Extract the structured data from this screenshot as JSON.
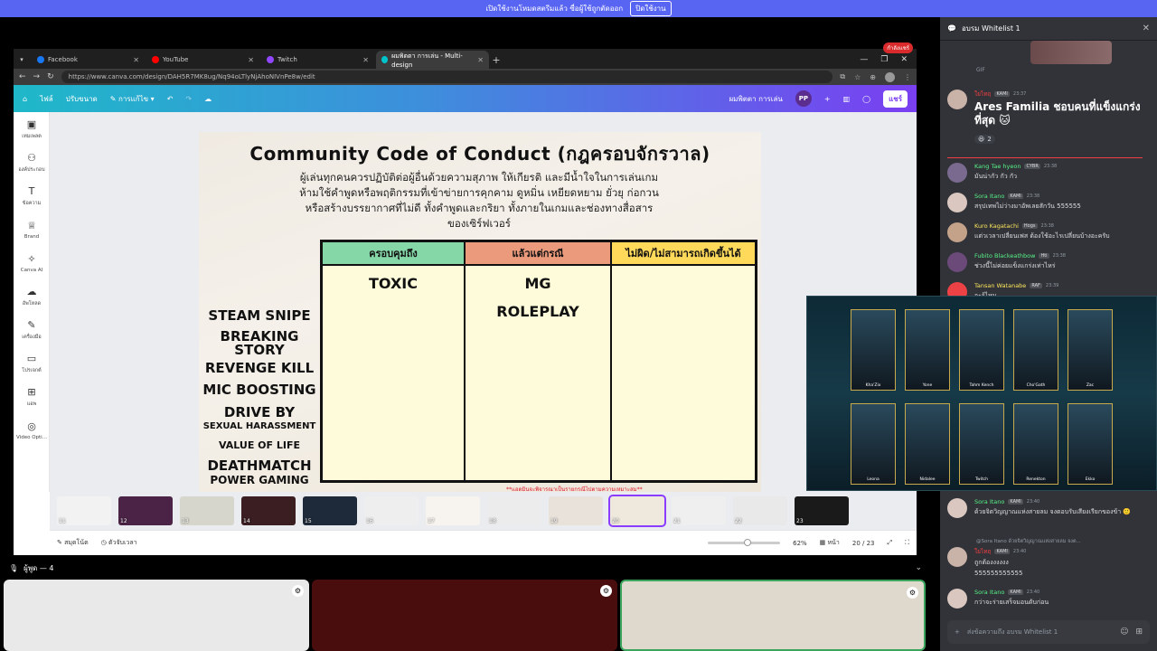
{
  "banner": {
    "text": "เปิดใช้งานโหมดสตรีมแล้ว ซื่อผู้ใช้ถูกตัดออก",
    "button": "ปิดใช้งาน"
  },
  "browser": {
    "tabs": [
      {
        "label": "Facebook",
        "color": "#1877f2"
      },
      {
        "label": "YouTube",
        "color": "#ff0000"
      },
      {
        "label": "Twitch",
        "color": "#9146ff"
      },
      {
        "label": "ผมพิตตา การเล่น - Multi-design",
        "color": "#00c4cc"
      }
    ],
    "rec_badge": "กำลังแชร์",
    "url": "https://www.canva.com/design/DAH5R7MK8ug/Nq94oLTlyNjAhoNIVnPe8w/edit"
  },
  "canva": {
    "top_left": [
      "ไฟล์",
      "ปรับขนาด",
      "การแก้ไข"
    ],
    "doc_name": "ผมพิตตา การเล่น",
    "avatar": "PP",
    "share": "แชร์",
    "sidebar": [
      {
        "icon": "▣",
        "label": "เทมเพลต"
      },
      {
        "icon": "⚇",
        "label": "องค์ประกอบ"
      },
      {
        "icon": "T",
        "label": "ข้อความ"
      },
      {
        "icon": "♕",
        "label": "Brand"
      },
      {
        "icon": "✧",
        "label": "Canva AI"
      },
      {
        "icon": "☁",
        "label": "อัพโหลด"
      },
      {
        "icon": "✎",
        "label": "เครื่องมือ"
      },
      {
        "icon": "▭",
        "label": "โปรเจกต์"
      },
      {
        "icon": "⊞",
        "label": "แอพ"
      },
      {
        "icon": "◎",
        "label": "Video Opti..."
      }
    ],
    "status": {
      "notes": "สมุดโน้ต",
      "timer": "ตัวจับเวลา",
      "zoom": "62%",
      "page_label": "หน้า",
      "pages": "20 / 23"
    }
  },
  "slide": {
    "title": "Community Code of Conduct (กฎครอบจักรวาล)",
    "body": "ผู้เล่นทุกคนควรปฏิบัติต่อผู้อื่นด้วยความสุภาพ ให้เกียรติ และมีน้ำใจในการเล่นเกม ห้ามใช้คำพูดหรือพฤติกรรมที่เข้าข่ายการคุกคาม ดูหมิ่น เหยียดหยาม ยั่วยุ ก่อกวน หรือสร้างบรรยากาศที่ไม่ดี ทั้งคำพูดและกริยา ทั้งภายในเกมและช่องทางสื่อสารของเซิร์ฟเวอร์",
    "headers": [
      "ครอบคุมถึง",
      "แล้วแต่กรณี",
      "ไม่ผิด/ไม่สามารถเกิดขึ้นได้"
    ],
    "col1": [
      "TOXIC"
    ],
    "col2": [
      "MG",
      "ROLEPLAY"
    ],
    "left_words": [
      "STEAM SNIPE",
      "BREAKING STORY",
      "REVENGE KILL",
      "MIC BOOSTING",
      "DRIVE BY",
      "SEXUAL HARASSMENT",
      "VALUE OF LIFE",
      "DEATHMATCH",
      "POWER GAMING"
    ],
    "footer": "**แอดมินจะพิจารณาเป็นรายกรณีไปตามความเหมาะสม**"
  },
  "thumbnails": [
    "11",
    "12",
    "13",
    "14",
    "15",
    "16",
    "17",
    "18",
    "19",
    "20",
    "21",
    "22",
    "23"
  ],
  "voice": {
    "header": "ผู้พูด — 4"
  },
  "chat": {
    "title": "อบรม Whitelist 1",
    "gif_label": "GIF",
    "messages": [
      {
        "name": "ใยไทฤ",
        "tag": "KAMI",
        "time": "23:37",
        "text": "Ares Familia ชอบคนที่แข็งแกร่งที่สุด 🐱",
        "reaction": "2",
        "color": "#f23f43"
      },
      {
        "name": "Kang Tae hyeon",
        "tag": "CYBR",
        "time": "23:38",
        "text": "มันน่ากัว กัว กัว",
        "color": "#57f287"
      },
      {
        "name": "Sora Itano",
        "tag": "KAMI",
        "time": "23:38",
        "text": "สรุปเทพไม่ว่างมาอัพเลยสักวัน 555555",
        "color": "#57f287"
      },
      {
        "name": "Kuro Kagatachi",
        "tag": "Hogs",
        "time": "23:38",
        "text": "แต่วเวลาเปลี่ยนเฟส ต้องใช้อะไรเปลี่ยนบ้างอะครับ",
        "color": "#fee75c"
      },
      {
        "name": "Fubito Blackeathbow",
        "tag": "Hti",
        "time": "23:38",
        "text": "ช่วงนี้ไม่ค่อยแข็งแกร่งเท่าไหร่",
        "color": "#57f287"
      },
      {
        "name": "Tansan Watanabe",
        "tag": "RAF",
        "time": "23:39",
        "text": "จะรู้ไหม",
        "color": "#fee75c"
      },
      {
        "name": "Sora Itano",
        "tag": "KAMI",
        "time": "23:40",
        "text": "ด้วยจิตวิญญาณแห่งสายลม จงตอบรับเสียงเรียกของข้า 🙂",
        "color": "#57f287"
      },
      {
        "name": "ใยไทฤ",
        "tag": "KAMI",
        "time": "23:40",
        "text": "ถูกต้องงงงงง",
        "color": "#f23f43"
      },
      {
        "name": "",
        "tag": "",
        "time": "",
        "text": "555555555555",
        "color": "#dbdee1"
      },
      {
        "name": "Sora Itano",
        "tag": "KAMI",
        "time": "23:40",
        "text": "กว่าจะร่ายเสร็จมอนดับก่อน",
        "color": "#57f287"
      }
    ],
    "reply": "@Sora Itano ด้วยจิตวิญญาณแห่งสายลม จงต...",
    "input_placeholder": "ส่งข้อความถึง อบรม Whitelist 1"
  },
  "game": {
    "cards": [
      "Kha'Zix",
      "Yone",
      "Tahm Kench",
      "Cho'Gath",
      "Zac",
      "Leona",
      "Nidalee",
      "Twitch",
      "Renekton",
      "Ekko"
    ]
  }
}
